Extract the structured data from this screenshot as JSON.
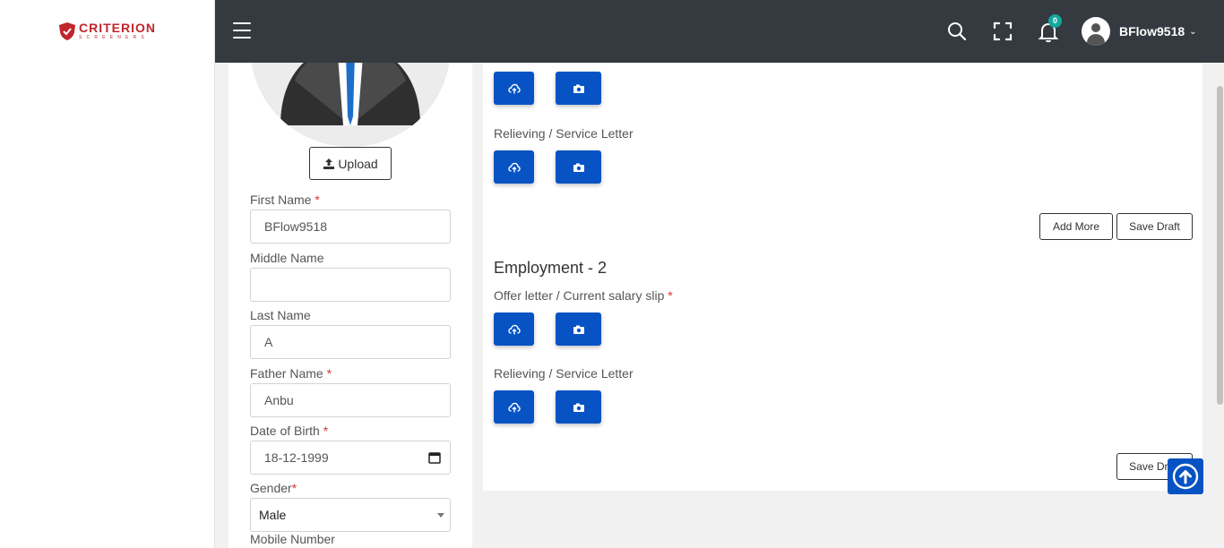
{
  "brand": {
    "name": "CRITERION",
    "tagline": "SCREENERS"
  },
  "topbar": {
    "notification_count": "0",
    "username": "BFlow9518",
    "icons": [
      "menu-icon",
      "search-icon",
      "fullscreen-icon",
      "bell-icon",
      "user-avatar-icon",
      "chevron-down-icon"
    ]
  },
  "profile": {
    "upload_label": "Upload",
    "fields": {
      "first_name": {
        "label": "First Name",
        "value": "BFlow9518",
        "required": true
      },
      "middle_name": {
        "label": "Middle Name",
        "value": ""
      },
      "last_name": {
        "label": "Last Name",
        "value": "A"
      },
      "father_name": {
        "label": "Father Name",
        "value": "Anbu",
        "required": true
      },
      "dob": {
        "label": "Date of Birth",
        "value": "18-12-1999",
        "required": true
      },
      "gender": {
        "label": "Gender",
        "value": "Male",
        "required": true
      },
      "mobile": {
        "label": "Mobile Number"
      }
    }
  },
  "documents": {
    "employment_1": {
      "relieving_label": "Relieving / Service Letter",
      "add_more_label": "Add More",
      "save_draft_label": "Save Draft"
    },
    "employment_2": {
      "title": "Employment - 2",
      "offer_label": "Offer letter / Current salary slip",
      "offer_required": "*",
      "relieving_label": "Relieving / Service Letter",
      "save_draft_label": "Save Draft"
    }
  },
  "colors": {
    "primary": "#0753c4",
    "topbar": "#343a40",
    "brand": "#c0262c",
    "badge": "#13a89e",
    "required": "#d9342b"
  }
}
